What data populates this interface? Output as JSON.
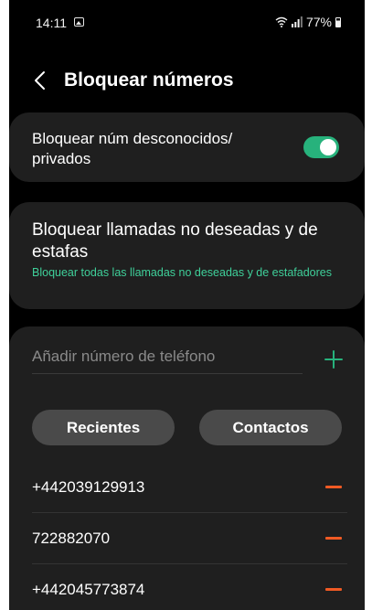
{
  "status_bar": {
    "time": "14:11",
    "battery": "77%"
  },
  "header": {
    "title": "Bloquear números"
  },
  "unknown_block": {
    "label": "Bloquear núm desconocidos/ privados",
    "enabled": true
  },
  "scam_block": {
    "title": "Bloquear llamadas no deseadas y de estafas",
    "subtitle": "Bloquear todas las llamadas no deseadas y de estafadores"
  },
  "add_number": {
    "placeholder": "Añadir número de teléfono"
  },
  "buttons": {
    "recent": "Recientes",
    "contacts": "Contactos"
  },
  "blocked_numbers": [
    "+442039129913",
    "722882070",
    "+442045773874"
  ],
  "colors": {
    "accent_green": "#27b27c",
    "subtitle_green": "#3fd09a",
    "remove_orange": "#f05a24"
  }
}
